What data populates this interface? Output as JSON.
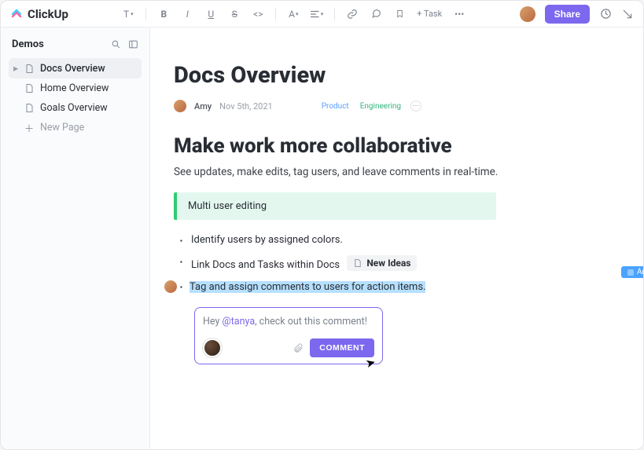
{
  "brand": "ClickUp",
  "topbar": {
    "add_task_label": "+ Task",
    "share_label": "Share"
  },
  "sidebar": {
    "title": "Demos",
    "items": [
      {
        "label": "Docs Overview",
        "active": true
      },
      {
        "label": "Home Overview",
        "active": false
      },
      {
        "label": "Goals Overview",
        "active": false
      }
    ],
    "new_page_label": "New Page"
  },
  "doc": {
    "title": "Docs Overview",
    "author": "Amy",
    "date": "Nov 5th, 2021",
    "tags": {
      "product": "Product",
      "engineering": "Engineering"
    },
    "h2": "Make work more collaborative",
    "subtitle": "See updates, make edits, tag users, and leave comments in real-time.",
    "callout": "Multi user editing",
    "bullets": {
      "b1": "Identify users by assigned colors.",
      "b2": "Link Docs and Tasks within Docs",
      "b2_chip": "New Ideas",
      "b3": "Tag and assign comments to users for action items."
    },
    "presence_user": "Amy"
  },
  "comment": {
    "prefix": "Hey ",
    "mention": "@tanya",
    "suffix": ", check out this comment!",
    "button_label": "COMMENT"
  }
}
